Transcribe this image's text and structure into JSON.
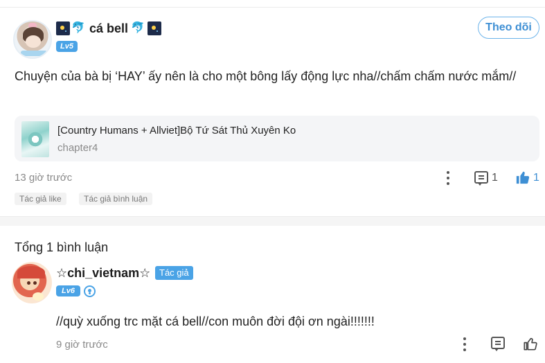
{
  "post": {
    "username": "cá bell",
    "level": "Lv5",
    "follow_label": "Theo dõi",
    "text": "Chuyện của bà bị ‘HAY’ ấy nên là cho một bông lấy động lực nha//chấm chấm nước mắm//",
    "story": {
      "title": "[Country Humans + Allviet]Bộ Tứ Sát Thủ Xuyên Ko",
      "chapter": "chapter4"
    },
    "time": "13 giờ trước",
    "comment_count": "1",
    "like_count": "1",
    "tags": [
      "Tác giả like",
      "Tác giả bình luận"
    ]
  },
  "comments": {
    "total_label": "Tổng 1 bình luận",
    "items": [
      {
        "username": "☆chi_vietnam☆",
        "author_badge": "Tác giả",
        "level": "Lv6",
        "text": "//quỳ xuống trc mặt cá bell//con muôn đời đội ơn ngài!!!!!!!",
        "time": "9 giờ trước"
      }
    ]
  },
  "colors": {
    "accent": "#4aa3e6",
    "like_active": "#3e8fd4",
    "muted_text": "#8a8a8a"
  },
  "icons": [
    "galaxy-emoji-icon",
    "dolphin-emoji-icon",
    "more-dots-icon",
    "comment-icon",
    "thumbs-up-icon",
    "verified-icon"
  ]
}
